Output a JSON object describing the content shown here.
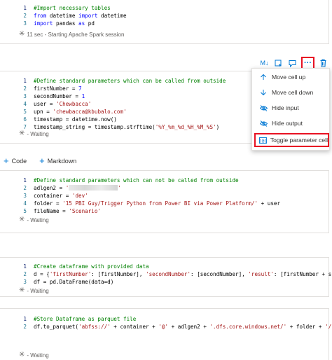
{
  "cells": [
    {
      "lines": [
        {
          "num": "1",
          "parts": [
            [
              "cm",
              "#Import necessary tables"
            ]
          ]
        },
        {
          "num": "2",
          "parts": [
            [
              "kw",
              "from"
            ],
            [
              "",
              " datetime "
            ],
            [
              "kw",
              "import"
            ],
            [
              "",
              " datetime"
            ]
          ]
        },
        {
          "num": "3",
          "parts": [
            [
              "kw",
              "import"
            ],
            [
              "",
              " pandas "
            ],
            [
              "kw",
              "as"
            ],
            [
              "",
              " pd"
            ]
          ]
        }
      ],
      "status": "11 sec - Starting Apache Spark session"
    },
    {
      "lines": [
        {
          "num": "1",
          "parts": [
            [
              "cm",
              "#Define standard parameters which can be called from outside"
            ]
          ]
        },
        {
          "num": "2",
          "parts": [
            [
              "",
              "firstNumber = "
            ],
            [
              "kw",
              "7"
            ]
          ]
        },
        {
          "num": "3",
          "parts": [
            [
              "",
              "secondNumber = "
            ],
            [
              "kw",
              "1"
            ]
          ]
        },
        {
          "num": "4",
          "parts": [
            [
              "",
              "user = "
            ],
            [
              "st",
              "'Chewbacca'"
            ]
          ]
        },
        {
          "num": "5",
          "parts": [
            [
              "",
              "upn = "
            ],
            [
              "st",
              "'chewbacca@kbubalo.com'"
            ]
          ]
        },
        {
          "num": "6",
          "parts": [
            [
              "",
              "timestamp = datetime.now()"
            ]
          ]
        },
        {
          "num": "7",
          "parts": [
            [
              "",
              "timestamp_string = timestamp.strftime("
            ],
            [
              "st",
              "'%Y_%m_%d_%H_%M_%S'"
            ],
            [
              "",
              ")"
            ]
          ]
        }
      ],
      "status": "- Waiting"
    },
    {
      "lines": [
        {
          "num": "1",
          "parts": [
            [
              "cm",
              "#Define standard parameters which can not be called from outside"
            ]
          ]
        },
        {
          "num": "2",
          "parts": [
            [
              "",
              "adlgen2 = "
            ],
            [
              "st",
              "'"
            ],
            [
              "redact",
              ""
            ],
            [
              "st",
              "'"
            ]
          ]
        },
        {
          "num": "3",
          "parts": [
            [
              "",
              "container = "
            ],
            [
              "st",
              "'dev'"
            ]
          ]
        },
        {
          "num": "4",
          "parts": [
            [
              "",
              "folder = "
            ],
            [
              "st",
              "'15 PBI Guy/Trigger Python from Power BI via Power Platform/'"
            ],
            [
              "",
              " + user"
            ]
          ]
        },
        {
          "num": "5",
          "parts": [
            [
              "",
              "fileName = "
            ],
            [
              "st",
              "'Scenario'"
            ]
          ]
        }
      ],
      "status": "- Waiting"
    },
    {
      "lines": [
        {
          "num": "1",
          "parts": [
            [
              "cm",
              "#Create dataframe with provided data"
            ]
          ]
        },
        {
          "num": "2",
          "parts": [
            [
              "",
              "d = {"
            ],
            [
              "st",
              "'firstNumber'"
            ],
            [
              "",
              ": [firstNumber], "
            ],
            [
              "st",
              "'secondNumber'"
            ],
            [
              "",
              ": [secondNumber], "
            ],
            [
              "st",
              "'result'"
            ],
            [
              "",
              ": [firstNumber + s"
            ]
          ]
        },
        {
          "num": "3",
          "parts": [
            [
              "",
              "df = pd.DataFrame(data=d)"
            ]
          ]
        }
      ],
      "status": "- Waiting"
    },
    {
      "lines": [
        {
          "num": "1",
          "parts": [
            [
              "cm",
              "#Store Dataframe as parquet file"
            ]
          ]
        },
        {
          "num": "2",
          "parts": [
            [
              "",
              "df.to_parquet("
            ],
            [
              "st",
              "'abfss://'"
            ],
            [
              "",
              " + container + "
            ],
            [
              "st",
              "'@'"
            ],
            [
              "",
              " + adlgen2 + "
            ],
            [
              "st",
              "'.dfs.core.windows.net/'"
            ],
            [
              "",
              " + folder + "
            ],
            [
              "st",
              "'/"
            ]
          ]
        }
      ],
      "status": "- Waiting"
    }
  ],
  "toolbar": {
    "markdown_label": "M↓"
  },
  "menu": {
    "items": [
      {
        "label": "Move cell up",
        "icon": "arrow-up-icon"
      },
      {
        "label": "Move cell down",
        "icon": "arrow-down-icon"
      },
      {
        "label": "Hide input",
        "icon": "eye-slash-icon"
      },
      {
        "label": "Hide output",
        "icon": "eye-slash-icon"
      },
      {
        "label": "Toggle parameter cell",
        "icon": "parameter-icon"
      }
    ]
  },
  "add_bar": {
    "code_label": "Code",
    "markdown_label": "Markdown"
  }
}
